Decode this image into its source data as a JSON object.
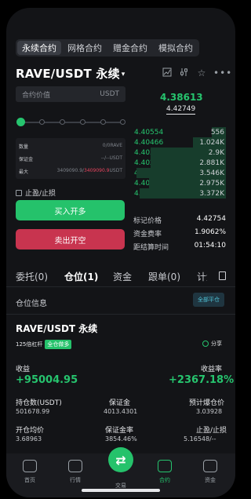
{
  "tabs": [
    "永续合约",
    "网格合约",
    "赠金合约",
    "模拟合约"
  ],
  "pair": {
    "name": "RAVE/USDT 永续",
    "caret": "▾"
  },
  "header_icons": [
    "candlestick-chart-icon",
    "settings-sliders-icon",
    "star-icon",
    "more-icon"
  ],
  "contract_value": {
    "label": "合约价值",
    "unit": "USDT"
  },
  "slider": {
    "value_percent": 0,
    "stops": 6
  },
  "order_info": {
    "rows": [
      {
        "label": "数量",
        "value": "0/0RAVE"
      },
      {
        "label": "保证金",
        "value": "--/--USDT"
      },
      {
        "label": "最大",
        "value_a": "3409090.9/",
        "value_b": "3409090.9",
        "unit": "USDT"
      }
    ]
  },
  "tpsl_label": "止盈/止损",
  "buy_label": "买入开多",
  "sell_label": "卖出开空",
  "price": {
    "last": "4.38613",
    "mark_sub": "4.42749"
  },
  "orderbook": [
    {
      "price": "4.40554",
      "qty": "556",
      "depth": 0.15
    },
    {
      "price": "4.40466",
      "qty": "1.024K",
      "depth": 0.35
    },
    {
      "price": "4.40378",
      "qty": "2.9K",
      "depth": 0.8
    },
    {
      "price": "4.40290",
      "qty": "2.881K",
      "depth": 0.8
    },
    {
      "price": "4.40202",
      "qty": "3.546K",
      "depth": 0.95
    },
    {
      "price": "4.40114",
      "qty": "2.975K",
      "depth": 0.82
    },
    {
      "price": "4.40026",
      "qty": "3.372K",
      "depth": 0.92
    }
  ],
  "market": {
    "mark_label": "标记价格",
    "mark_value": "4.42754",
    "funding_label": "资金费率",
    "funding_value": "1.9062%",
    "settle_label": "距结算时间",
    "settle_value": "01:54:10"
  },
  "position_tabs": [
    "委托(0)",
    "仓位(1)",
    "资金",
    "跟单(0)",
    "计划"
  ],
  "position_info_label": "仓位信息",
  "close_all_label": "全部平仓",
  "position": {
    "pair": "RAVE/USDT 永续",
    "leverage": "125倍杠杆",
    "mode": "全仓做多",
    "share_label": "分享",
    "pnl_label": "收益",
    "pnl_value": "+95004.95",
    "roe_label": "收益率",
    "roe_value": "+2367.18%",
    "fields": [
      {
        "label": "持仓数(USDT)",
        "value": "501678.99"
      },
      {
        "label": "保证金",
        "value": "4013.4301"
      },
      {
        "label": "预计爆仓价",
        "value": "3.03928"
      },
      {
        "label": "开仓均价",
        "value": "3.68963"
      },
      {
        "label": "保证金率",
        "value": "3854.46%"
      },
      {
        "label": "止盈/止损",
        "value": "5.16548/--"
      }
    ]
  },
  "nav": [
    "首页",
    "行情",
    "交易",
    "合约",
    "资金"
  ],
  "colors": {
    "green": "#25c26b",
    "red": "#c8344f",
    "bg": "#131417"
  }
}
